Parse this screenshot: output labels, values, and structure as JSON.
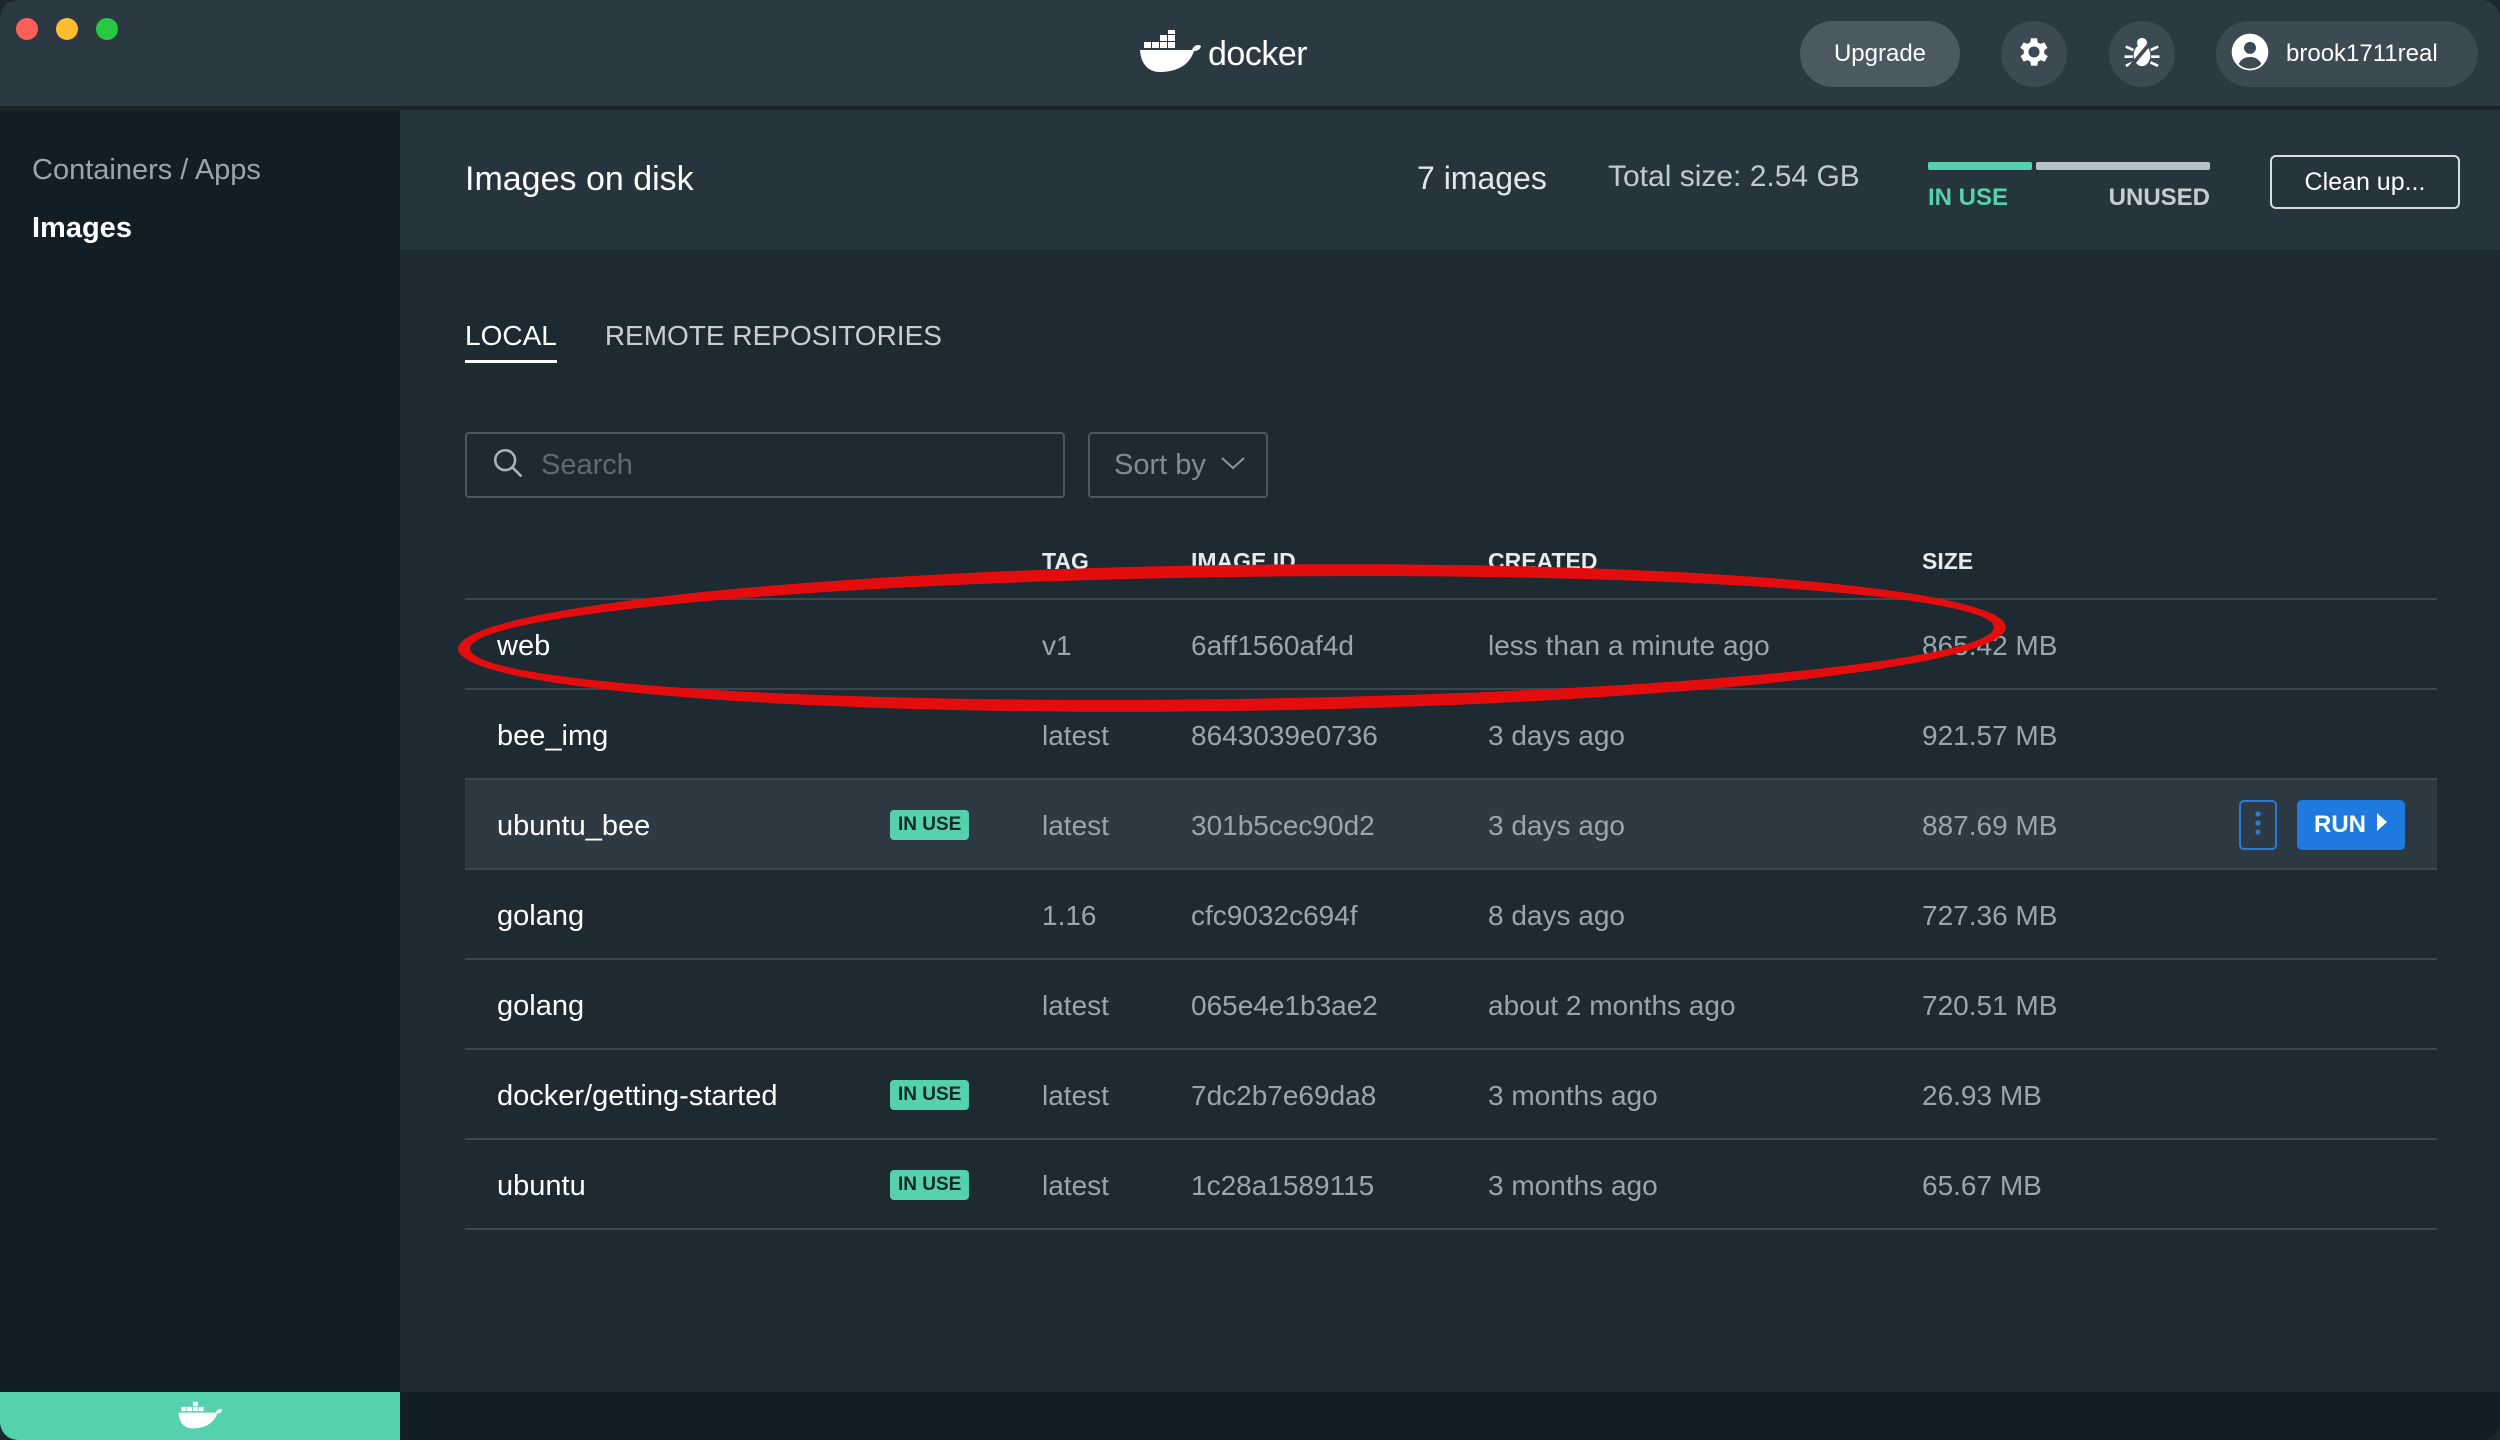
{
  "titlebar": {
    "brand": "docker",
    "upgrade_label": "Upgrade",
    "settings_icon": "gear-icon",
    "troubleshoot_icon": "bug-icon",
    "account_icon": "user-avatar-icon",
    "username": "brook1711real"
  },
  "sidebar": {
    "items": [
      {
        "label": "Containers / Apps",
        "active": false
      },
      {
        "label": "Images",
        "active": true
      }
    ],
    "footer_icon": "docker-whale-icon",
    "footer_color": "#56d1ad"
  },
  "header": {
    "title": "Images on disk",
    "count": "7 images",
    "total_size": "Total size: 2.54 GB",
    "in_use_label": "IN USE",
    "unused_label": "UNUSED",
    "in_use_fraction": 0.37,
    "cleanup_label": "Clean up..."
  },
  "tabs": [
    {
      "label": "LOCAL",
      "active": true
    },
    {
      "label": "REMOTE REPOSITORIES",
      "active": false
    }
  ],
  "search": {
    "placeholder": "Search",
    "value": ""
  },
  "sort": {
    "label": "Sort by"
  },
  "table": {
    "headers": {
      "tag": "TAG",
      "image_id": "IMAGE ID",
      "created": "CREATED",
      "size": "SIZE"
    },
    "badge_label": "IN USE",
    "run_label": "RUN",
    "rows": [
      {
        "name": "web",
        "in_use": false,
        "tag": "v1",
        "id": "6aff1560af4d",
        "created": "less than a minute ago",
        "size": "865.42 MB"
      },
      {
        "name": "bee_img",
        "in_use": false,
        "tag": "latest",
        "id": "8643039e0736",
        "created": "3 days ago",
        "size": "921.57 MB"
      },
      {
        "name": "ubuntu_bee",
        "in_use": true,
        "tag": "latest",
        "id": "301b5cec90d2",
        "created": "3 days ago",
        "size": "887.69 MB",
        "hovered": true
      },
      {
        "name": "golang",
        "in_use": false,
        "tag": "1.16",
        "id": "cfc9032c694f",
        "created": "8 days ago",
        "size": "727.36 MB"
      },
      {
        "name": "golang",
        "in_use": false,
        "tag": "latest",
        "id": "065e4e1b3ae2",
        "created": "about 2 months ago",
        "size": "720.51 MB"
      },
      {
        "name": "docker/getting-started",
        "in_use": true,
        "tag": "latest",
        "id": "7dc2b7e69da8",
        "created": "3 months ago",
        "size": "26.93 MB"
      },
      {
        "name": "ubuntu",
        "in_use": true,
        "tag": "latest",
        "id": "1c28a1589115",
        "created": "3 months ago",
        "size": "65.67 MB"
      }
    ]
  },
  "annotation": {
    "color": "#e40d0d",
    "shape": "ellipse",
    "target_row": "web"
  }
}
